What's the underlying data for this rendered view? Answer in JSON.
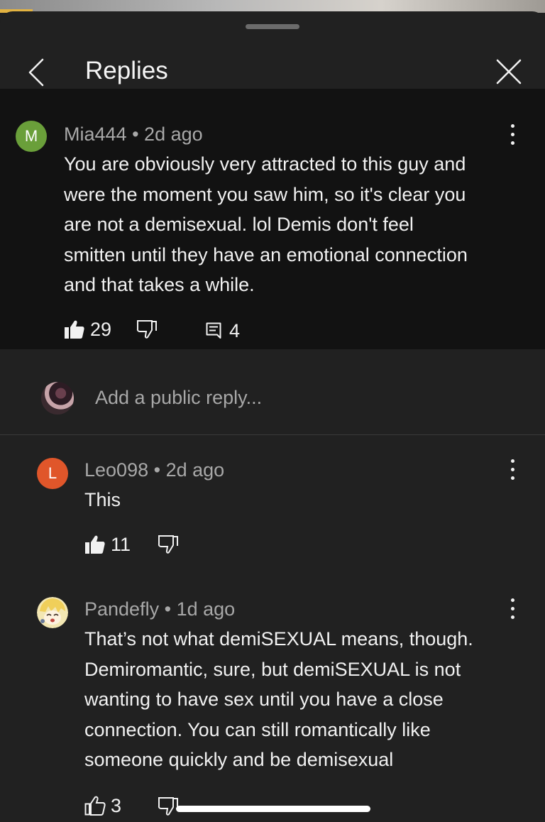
{
  "header": {
    "title": "Replies"
  },
  "comments": [
    {
      "avatar_letter": "M",
      "avatar_color": "#6a9f3a",
      "author": "Mia444",
      "separator": "•",
      "time": "2d ago",
      "lines": [
        "You are obviously very attracted to this guy and",
        "were the moment you saw him, so it's clear you",
        "are not a demisexual. lol  Demis don't feel",
        "smitten until they have an emotional connection",
        "and that takes a while."
      ],
      "likes": "29",
      "replies": "4"
    },
    {
      "avatar_letter": "L",
      "avatar_color": "#e0562a",
      "author": "Leo098",
      "separator": "•",
      "time": "2d ago",
      "lines": [
        "This"
      ],
      "likes": "11"
    },
    {
      "author": "Pandefly",
      "separator": "•",
      "time": "1d ago",
      "lines": [
        "That’s not what demiSEXUAL means, though.",
        "Demiromantic, sure, but demiSEXUAL is not",
        "wanting to have sex until you have a close",
        "connection. You can still romantically like",
        "someone quickly and be demisexual"
      ],
      "likes": "3"
    }
  ],
  "reply_box": {
    "placeholder": "Add a public reply..."
  },
  "icons": {
    "back": "chevron-left-icon",
    "close": "close-icon",
    "like": "thumbs-up-icon",
    "dislike": "thumbs-down-icon",
    "reply": "comment-icon",
    "more": "more-vert-icon"
  }
}
